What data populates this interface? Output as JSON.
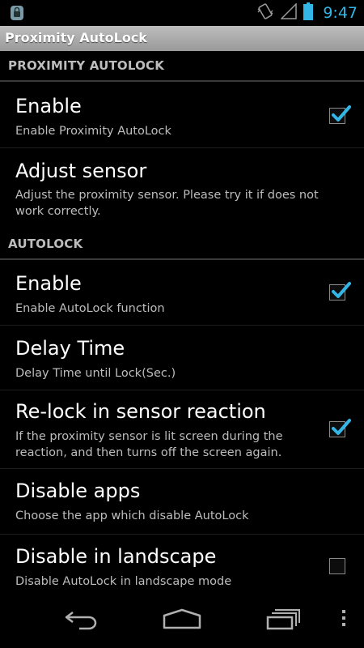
{
  "status_bar": {
    "time": "9:47",
    "icons": [
      "app-notification-icon",
      "vibrate-icon",
      "signal-icon",
      "battery-icon"
    ]
  },
  "titlebar": {
    "title": "Proximity AutoLock"
  },
  "sections": [
    {
      "header": "PROXIMITY AUTOLOCK",
      "items": [
        {
          "title": "Enable",
          "summary": "Enable Proximity AutoLock",
          "checkbox": true,
          "checked": true
        },
        {
          "title": "Adjust sensor",
          "summary": "Adjust the proximity sensor. Please try it if does not work correctly.",
          "checkbox": false
        }
      ]
    },
    {
      "header": "AUTOLOCK",
      "items": [
        {
          "title": "Enable",
          "summary": "Enable AutoLock function",
          "checkbox": true,
          "checked": true
        },
        {
          "title": "Delay Time",
          "summary": "Delay Time until Lock(Sec.)",
          "checkbox": false
        },
        {
          "title": "Re-lock in sensor reaction",
          "summary": "If the proximity sensor is lit screen during the reaction, and then turns off the screen again.",
          "checkbox": true,
          "checked": true
        },
        {
          "title": "Disable apps",
          "summary": "Choose the app which disable AutoLock",
          "checkbox": false
        },
        {
          "title": "Disable in landscape",
          "summary": "Disable AutoLock in landscape mode",
          "checkbox": true,
          "checked": false
        }
      ]
    }
  ],
  "nav_bar": {
    "buttons": [
      "back-icon",
      "home-icon",
      "recents-icon",
      "overflow-menu-icon"
    ]
  },
  "colors": {
    "accent": "#33b5e5",
    "background": "#000000",
    "summary_text": "#bdbdbd"
  }
}
